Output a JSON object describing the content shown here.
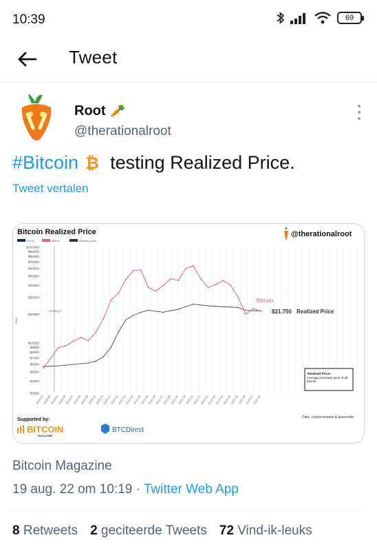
{
  "status_bar": {
    "time": "10:39",
    "battery": "69"
  },
  "header": {
    "title": "Tweet"
  },
  "author": {
    "name": "Root",
    "name_emoji": "🥕",
    "handle": "@therationalroot"
  },
  "tweet": {
    "hashtag": "#Bitcoin",
    "text": "testing Realized Price.",
    "translate_label": "Tweet vertalen"
  },
  "chart": {
    "title": "Bitcoin Realized Price",
    "handle": "@therationalroot",
    "legend": [
      "ATH's",
      "Bitcoin",
      "realized_price"
    ],
    "bitcoin_label": "Bitcoin",
    "realized_value": "$21.750",
    "realized_label": "Realized Price",
    "halving_label": "Halving 3",
    "ylabel": "Price",
    "note_title": "Realized Price:",
    "note_text": "Average purchase price of all bitcoin.",
    "data_source": "Data: cryptocompare & glassnode",
    "supported_by": "Supported by:",
    "sponsor1": "BITCOIN",
    "sponsor1_sub": "MAGAZINE",
    "sponsor2": "BTCDirect",
    "colors": {
      "bitcoin": "#d9667f",
      "realized": "#333333",
      "ath": "#1a2a4a",
      "orange": "#f7931a"
    }
  },
  "chart_data": {
    "type": "line",
    "title": "Bitcoin Realized Price",
    "ylabel": "Price",
    "yscale": "log",
    "ylim": [
      3000,
      100000
    ],
    "y_ticks": [
      "$3000",
      "$4000",
      "$5000",
      "$6000",
      "$7000",
      "$8000",
      "$9000",
      "$10000",
      "$20000",
      "$30000",
      "$40000",
      "$50000",
      "$60000",
      "$70000",
      "$80000",
      "$90000",
      "$100000"
    ],
    "y_tick_values": [
      3000,
      4000,
      5000,
      6000,
      7000,
      8000,
      9000,
      10000,
      20000,
      30000,
      40000,
      50000,
      60000,
      70000,
      80000,
      90000,
      100000
    ],
    "x": [
      "2020-03",
      "2020-04",
      "2020-05",
      "2020-06",
      "2020-07",
      "2020-08",
      "2020-09",
      "2020-10",
      "2020-11",
      "2020-12",
      "2021-01",
      "2021-02",
      "2021-03",
      "2021-04",
      "2021-05",
      "2021-06",
      "2021-07",
      "2021-08",
      "2021-09",
      "2021-10",
      "2021-11",
      "2021-12",
      "2022-01",
      "2022-02",
      "2022-03",
      "2022-04",
      "2022-05",
      "2022-06",
      "2022-07",
      "2022-08"
    ],
    "series": [
      {
        "name": "Bitcoin",
        "values": [
          5500,
          7000,
          9000,
          9400,
          10500,
          11500,
          10600,
          13000,
          18000,
          28000,
          33000,
          46000,
          57000,
          58000,
          38000,
          35000,
          40000,
          47000,
          45000,
          60000,
          64000,
          47000,
          38000,
          41000,
          45000,
          40000,
          30000,
          20000,
          23000,
          21500
        ]
      },
      {
        "name": "realized_price",
        "values": [
          5700,
          5750,
          5800,
          5900,
          6000,
          6100,
          6200,
          6500,
          7200,
          9000,
          13000,
          17500,
          19500,
          21000,
          22000,
          21500,
          21000,
          21800,
          22500,
          24000,
          25500,
          25000,
          24500,
          24200,
          24000,
          23800,
          23500,
          22000,
          21800,
          21750
        ]
      }
    ],
    "annotations": [
      "Halving 3",
      "$21.750  Realized Price"
    ]
  },
  "source": "Bitcoin Magazine",
  "meta": {
    "date": "19 aug. 22 om 10:19",
    "separator": "·",
    "app": "Twitter Web App"
  },
  "stats": {
    "retweets_count": "8",
    "retweets_label": "Retweets",
    "quotes_count": "2",
    "quotes_label": "geciteerde Tweets",
    "likes_count": "72",
    "likes_label": "Vind-ik-leuks"
  }
}
